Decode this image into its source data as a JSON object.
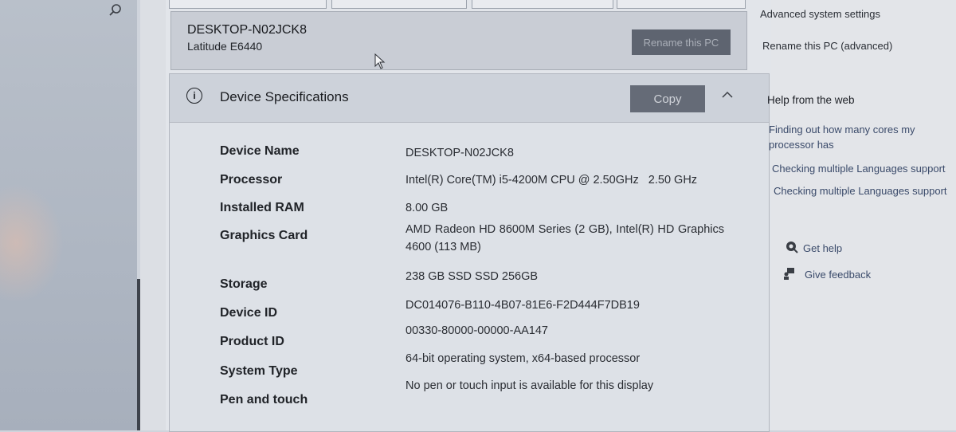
{
  "pc": {
    "name": "DESKTOP-N02JCK8",
    "model": "Latitude E6440",
    "rename_label": "Rename this PC"
  },
  "specs": {
    "title": "Device Specifications",
    "copy_label": "Copy",
    "rows": [
      {
        "label": "Device Name",
        "value": "DESKTOP-N02JCK8"
      },
      {
        "label": "Processor",
        "value": "Intel(R) Core(TM) i5-4200M CPU @ 2.50GHz   2.50 GHz"
      },
      {
        "label": "Installed RAM",
        "value": "8.00 GB"
      },
      {
        "label": "Graphics Card",
        "value": "AMD Radeon HD 8600M Series (2 GB), Intel(R) HD Graphics 4600 (113 MB)"
      },
      {
        "label": "Storage",
        "value": "238 GB SSD SSD 256GB"
      },
      {
        "label": "Device ID",
        "value": "DC014076-B110-4B07-81E6-F2D444F7DB19"
      },
      {
        "label": "Product ID",
        "value": "00330-80000-00000-AA147"
      },
      {
        "label": "System Type",
        "value": "64-bit operating system, x64-based processor"
      },
      {
        "label": "Pen and touch",
        "value": "No pen or touch input is available for this display"
      }
    ]
  },
  "sidebar": {
    "advanced_settings": "Advanced system settings",
    "rename_advanced": "Rename this PC (advanced)",
    "help_heading": "Help from the web",
    "help_links": [
      "Finding out how many cores my processor has",
      "Checking multiple Languages support",
      "Checking multiple Languages support"
    ],
    "get_help": "Get help",
    "give_feedback": "Give feedback"
  }
}
